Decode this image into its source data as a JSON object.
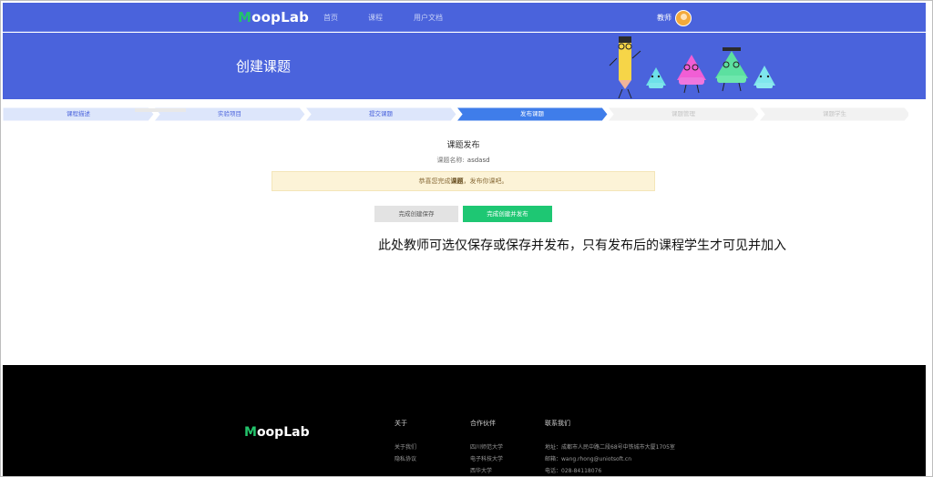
{
  "header": {
    "logo_first": "M",
    "logo_rest": "oopLab",
    "nav": {
      "home": "首页",
      "course": "课程",
      "docs": "用户文档"
    },
    "user_name": "教师"
  },
  "hero": {
    "title": "创建课题"
  },
  "steps": [
    {
      "label": "课程描述",
      "state": "done"
    },
    {
      "label": "实验项目",
      "state": "done"
    },
    {
      "label": "提交课题",
      "state": "done"
    },
    {
      "label": "发布课题",
      "state": "active"
    },
    {
      "label": "课题管理",
      "state": "pending"
    },
    {
      "label": "课题学生",
      "state": "pending"
    }
  ],
  "main": {
    "title": "课题发布",
    "course_name_label": "课题名称:",
    "course_name_value": "asdasd",
    "notice_prefix": "恭喜您完成",
    "notice_bold": "课题",
    "notice_suffix": "，发布你课吧。",
    "save_button": "完成创建保存",
    "publish_button": "完成创建并发布",
    "annotation": "此处教师可选仅保存或保存并发布，只有发布后的课程学生才可见并加入"
  },
  "footer": {
    "logo_first": "M",
    "logo_rest": "oopLab",
    "about": {
      "heading": "关于",
      "items": [
        "关于我们",
        "隐私协议"
      ]
    },
    "partners": {
      "heading": "合作伙伴",
      "items": [
        "四川师范大学",
        "电子科技大学",
        "西华大学"
      ]
    },
    "contact": {
      "heading": "联系我们",
      "address": "地址：成都市人民中路二段68号中铁城市大厦1705室",
      "email": "邮箱：wang.rhong@uniotsoft.cn",
      "phone": "电话：028-84118076"
    }
  },
  "colors": {
    "brand_blue": "#4a63dc",
    "brand_green": "#1ec773",
    "step_done": "#dde6fb",
    "step_active": "#3f7dea",
    "step_pending": "#f2f2f2"
  }
}
